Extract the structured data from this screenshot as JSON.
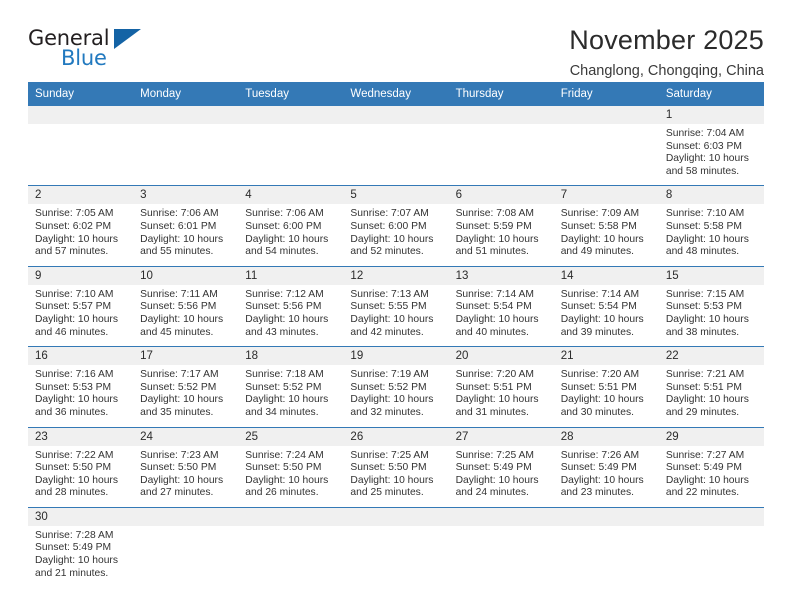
{
  "logo": {
    "word_one": "General",
    "word_two": "Blue",
    "flag_icon": "blue-triangle-flag"
  },
  "header": {
    "title": "November 2025",
    "subtitle": "Changlong, Chongqing, China"
  },
  "calendar": {
    "weekday_headers": [
      "Sunday",
      "Monday",
      "Tuesday",
      "Wednesday",
      "Thursday",
      "Friday",
      "Saturday"
    ],
    "labels": {
      "sunrise": "Sunrise:",
      "sunset": "Sunset:",
      "daylight": "Daylight:"
    },
    "weeks": [
      [
        {
          "day": "",
          "empty": true
        },
        {
          "day": "",
          "empty": true
        },
        {
          "day": "",
          "empty": true
        },
        {
          "day": "",
          "empty": true
        },
        {
          "day": "",
          "empty": true
        },
        {
          "day": "",
          "empty": true
        },
        {
          "day": "1",
          "sunrise": "Sunrise: 7:04 AM",
          "sunset": "Sunset: 6:03 PM",
          "daylight_line1": "Daylight: 10 hours",
          "daylight_line2": "and 58 minutes."
        }
      ],
      [
        {
          "day": "2",
          "sunrise": "Sunrise: 7:05 AM",
          "sunset": "Sunset: 6:02 PM",
          "daylight_line1": "Daylight: 10 hours",
          "daylight_line2": "and 57 minutes."
        },
        {
          "day": "3",
          "sunrise": "Sunrise: 7:06 AM",
          "sunset": "Sunset: 6:01 PM",
          "daylight_line1": "Daylight: 10 hours",
          "daylight_line2": "and 55 minutes."
        },
        {
          "day": "4",
          "sunrise": "Sunrise: 7:06 AM",
          "sunset": "Sunset: 6:00 PM",
          "daylight_line1": "Daylight: 10 hours",
          "daylight_line2": "and 54 minutes."
        },
        {
          "day": "5",
          "sunrise": "Sunrise: 7:07 AM",
          "sunset": "Sunset: 6:00 PM",
          "daylight_line1": "Daylight: 10 hours",
          "daylight_line2": "and 52 minutes."
        },
        {
          "day": "6",
          "sunrise": "Sunrise: 7:08 AM",
          "sunset": "Sunset: 5:59 PM",
          "daylight_line1": "Daylight: 10 hours",
          "daylight_line2": "and 51 minutes."
        },
        {
          "day": "7",
          "sunrise": "Sunrise: 7:09 AM",
          "sunset": "Sunset: 5:58 PM",
          "daylight_line1": "Daylight: 10 hours",
          "daylight_line2": "and 49 minutes."
        },
        {
          "day": "8",
          "sunrise": "Sunrise: 7:10 AM",
          "sunset": "Sunset: 5:58 PM",
          "daylight_line1": "Daylight: 10 hours",
          "daylight_line2": "and 48 minutes."
        }
      ],
      [
        {
          "day": "9",
          "sunrise": "Sunrise: 7:10 AM",
          "sunset": "Sunset: 5:57 PM",
          "daylight_line1": "Daylight: 10 hours",
          "daylight_line2": "and 46 minutes."
        },
        {
          "day": "10",
          "sunrise": "Sunrise: 7:11 AM",
          "sunset": "Sunset: 5:56 PM",
          "daylight_line1": "Daylight: 10 hours",
          "daylight_line2": "and 45 minutes."
        },
        {
          "day": "11",
          "sunrise": "Sunrise: 7:12 AM",
          "sunset": "Sunset: 5:56 PM",
          "daylight_line1": "Daylight: 10 hours",
          "daylight_line2": "and 43 minutes."
        },
        {
          "day": "12",
          "sunrise": "Sunrise: 7:13 AM",
          "sunset": "Sunset: 5:55 PM",
          "daylight_line1": "Daylight: 10 hours",
          "daylight_line2": "and 42 minutes."
        },
        {
          "day": "13",
          "sunrise": "Sunrise: 7:14 AM",
          "sunset": "Sunset: 5:54 PM",
          "daylight_line1": "Daylight: 10 hours",
          "daylight_line2": "and 40 minutes."
        },
        {
          "day": "14",
          "sunrise": "Sunrise: 7:14 AM",
          "sunset": "Sunset: 5:54 PM",
          "daylight_line1": "Daylight: 10 hours",
          "daylight_line2": "and 39 minutes."
        },
        {
          "day": "15",
          "sunrise": "Sunrise: 7:15 AM",
          "sunset": "Sunset: 5:53 PM",
          "daylight_line1": "Daylight: 10 hours",
          "daylight_line2": "and 38 minutes."
        }
      ],
      [
        {
          "day": "16",
          "sunrise": "Sunrise: 7:16 AM",
          "sunset": "Sunset: 5:53 PM",
          "daylight_line1": "Daylight: 10 hours",
          "daylight_line2": "and 36 minutes."
        },
        {
          "day": "17",
          "sunrise": "Sunrise: 7:17 AM",
          "sunset": "Sunset: 5:52 PM",
          "daylight_line1": "Daylight: 10 hours",
          "daylight_line2": "and 35 minutes."
        },
        {
          "day": "18",
          "sunrise": "Sunrise: 7:18 AM",
          "sunset": "Sunset: 5:52 PM",
          "daylight_line1": "Daylight: 10 hours",
          "daylight_line2": "and 34 minutes."
        },
        {
          "day": "19",
          "sunrise": "Sunrise: 7:19 AM",
          "sunset": "Sunset: 5:52 PM",
          "daylight_line1": "Daylight: 10 hours",
          "daylight_line2": "and 32 minutes."
        },
        {
          "day": "20",
          "sunrise": "Sunrise: 7:20 AM",
          "sunset": "Sunset: 5:51 PM",
          "daylight_line1": "Daylight: 10 hours",
          "daylight_line2": "and 31 minutes."
        },
        {
          "day": "21",
          "sunrise": "Sunrise: 7:20 AM",
          "sunset": "Sunset: 5:51 PM",
          "daylight_line1": "Daylight: 10 hours",
          "daylight_line2": "and 30 minutes."
        },
        {
          "day": "22",
          "sunrise": "Sunrise: 7:21 AM",
          "sunset": "Sunset: 5:51 PM",
          "daylight_line1": "Daylight: 10 hours",
          "daylight_line2": "and 29 minutes."
        }
      ],
      [
        {
          "day": "23",
          "sunrise": "Sunrise: 7:22 AM",
          "sunset": "Sunset: 5:50 PM",
          "daylight_line1": "Daylight: 10 hours",
          "daylight_line2": "and 28 minutes."
        },
        {
          "day": "24",
          "sunrise": "Sunrise: 7:23 AM",
          "sunset": "Sunset: 5:50 PM",
          "daylight_line1": "Daylight: 10 hours",
          "daylight_line2": "and 27 minutes."
        },
        {
          "day": "25",
          "sunrise": "Sunrise: 7:24 AM",
          "sunset": "Sunset: 5:50 PM",
          "daylight_line1": "Daylight: 10 hours",
          "daylight_line2": "and 26 minutes."
        },
        {
          "day": "26",
          "sunrise": "Sunrise: 7:25 AM",
          "sunset": "Sunset: 5:50 PM",
          "daylight_line1": "Daylight: 10 hours",
          "daylight_line2": "and 25 minutes."
        },
        {
          "day": "27",
          "sunrise": "Sunrise: 7:25 AM",
          "sunset": "Sunset: 5:49 PM",
          "daylight_line1": "Daylight: 10 hours",
          "daylight_line2": "and 24 minutes."
        },
        {
          "day": "28",
          "sunrise": "Sunrise: 7:26 AM",
          "sunset": "Sunset: 5:49 PM",
          "daylight_line1": "Daylight: 10 hours",
          "daylight_line2": "and 23 minutes."
        },
        {
          "day": "29",
          "sunrise": "Sunrise: 7:27 AM",
          "sunset": "Sunset: 5:49 PM",
          "daylight_line1": "Daylight: 10 hours",
          "daylight_line2": "and 22 minutes."
        }
      ],
      [
        {
          "day": "30",
          "sunrise": "Sunrise: 7:28 AM",
          "sunset": "Sunset: 5:49 PM",
          "daylight_line1": "Daylight: 10 hours",
          "daylight_line2": "and 21 minutes."
        },
        {
          "day": "",
          "empty": true
        },
        {
          "day": "",
          "empty": true
        },
        {
          "day": "",
          "empty": true
        },
        {
          "day": "",
          "empty": true
        },
        {
          "day": "",
          "empty": true
        },
        {
          "day": "",
          "empty": true
        }
      ]
    ]
  },
  "colors": {
    "header_blue": "#3479b6",
    "logo_blue": "#2179bf",
    "daynum_band": "#f0f0f0",
    "text": "#333333"
  }
}
